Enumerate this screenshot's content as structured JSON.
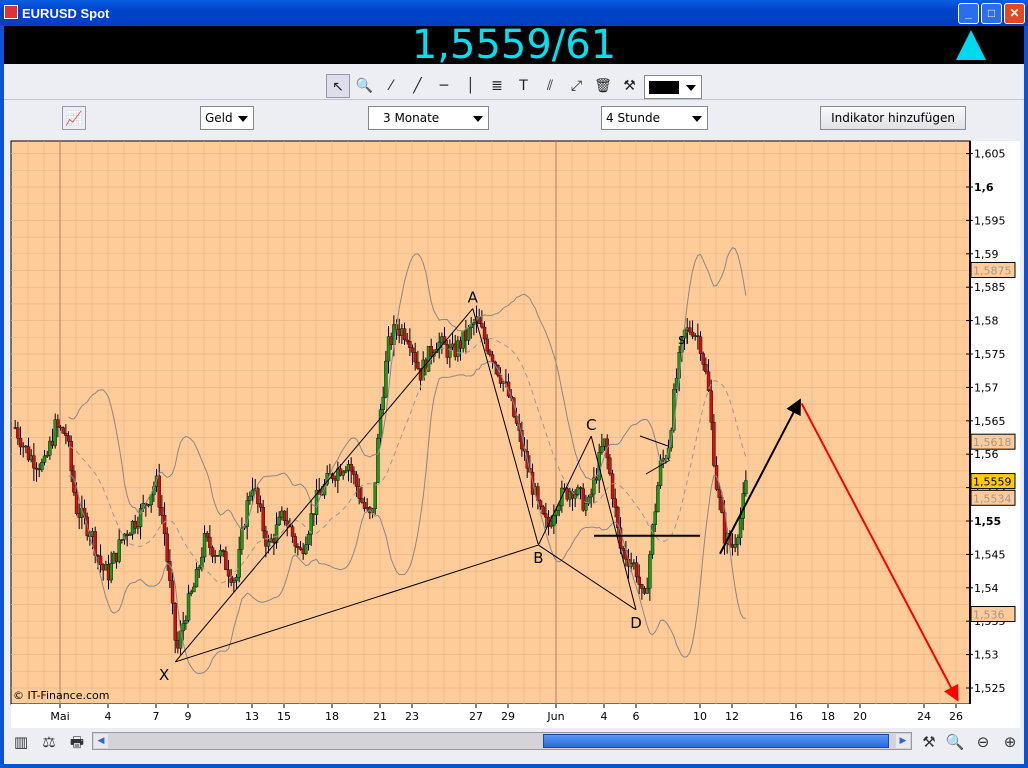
{
  "window": {
    "title": "EURUSD Spot",
    "minimize": "_",
    "maximize": "□",
    "close": "✕"
  },
  "quote": {
    "text": "1,5559/61",
    "direction": "up"
  },
  "toolbar": {
    "tools": [
      {
        "name": "pointer-tool",
        "glyph": "↖"
      },
      {
        "name": "zoom-tool",
        "glyph": "🔍"
      },
      {
        "name": "line-segment-tool",
        "glyph": "⁄"
      },
      {
        "name": "trendline-tool",
        "glyph": "╱"
      },
      {
        "name": "horizontal-line-tool",
        "glyph": "─"
      },
      {
        "name": "vertical-line-tool",
        "glyph": "│"
      },
      {
        "name": "fibonacci-tool",
        "glyph": "≣"
      },
      {
        "name": "text-tool",
        "glyph": "T"
      },
      {
        "name": "parallel-lines-tool",
        "glyph": "⫽"
      },
      {
        "name": "arrow-tool",
        "glyph": "⤢"
      },
      {
        "name": "delete-tool",
        "glyph": "🗑"
      },
      {
        "name": "settings-tool",
        "glyph": "⚒"
      }
    ],
    "color": "#000000"
  },
  "controls": {
    "price_type": "Geld",
    "range": "3 Monate",
    "interval": "4 Stunde",
    "add_indicator": "Indikator hinzufügen"
  },
  "chart_data": {
    "type": "candlestick",
    "symbol": "EURUSD",
    "ylim": [
      1.522,
      1.607
    ],
    "y_ticks": [
      "1,605",
      "1,6",
      "1,595",
      "1,59",
      "1,585",
      "1,58",
      "1,575",
      "1,57",
      "1,565",
      "1,56",
      "1,555",
      "1,55",
      "1,545",
      "1,54",
      "1,535",
      "1,53",
      "1,525"
    ],
    "y_tick_values": [
      1.605,
      1.6,
      1.595,
      1.59,
      1.585,
      1.58,
      1.575,
      1.57,
      1.565,
      1.56,
      1.555,
      1.55,
      1.545,
      1.54,
      1.535,
      1.53,
      1.525
    ],
    "x_labels": [
      {
        "t": "Mai",
        "d": 0
      },
      {
        "t": "4",
        "d": 3
      },
      {
        "t": "7",
        "d": 6
      },
      {
        "t": "9",
        "d": 8
      },
      {
        "t": "13",
        "d": 12
      },
      {
        "t": "15",
        "d": 14
      },
      {
        "t": "18",
        "d": 17
      },
      {
        "t": "21",
        "d": 20
      },
      {
        "t": "23",
        "d": 22
      },
      {
        "t": "27",
        "d": 26
      },
      {
        "t": "29",
        "d": 28
      },
      {
        "t": "Jun",
        "d": 31
      },
      {
        "t": "4",
        "d": 34
      },
      {
        "t": "6",
        "d": 36
      },
      {
        "t": "10",
        "d": 40
      },
      {
        "t": "12",
        "d": 42
      },
      {
        "t": "16",
        "d": 46
      },
      {
        "t": "18",
        "d": 48
      },
      {
        "t": "20",
        "d": 50
      },
      {
        "t": "24",
        "d": 54
      },
      {
        "t": "26",
        "d": 56
      }
    ],
    "xlim_days": [
      -2.9,
      57.8
    ],
    "price_path": [
      [
        -2.8,
        1.564
      ],
      [
        -2,
        1.56
      ],
      [
        -1,
        1.558
      ],
      [
        -0.3,
        1.564
      ],
      [
        0.4,
        1.563
      ],
      [
        1,
        1.552
      ],
      [
        2,
        1.548
      ],
      [
        2.6,
        1.543
      ],
      [
        3,
        1.542
      ],
      [
        4,
        1.548
      ],
      [
        5,
        1.551
      ],
      [
        6,
        1.556
      ],
      [
        6.5,
        1.549
      ],
      [
        7,
        1.537
      ],
      [
        7.3,
        1.53
      ],
      [
        7.8,
        1.536
      ],
      [
        8.5,
        1.541
      ],
      [
        9,
        1.547
      ],
      [
        10,
        1.545
      ],
      [
        11,
        1.541
      ],
      [
        11.5,
        1.55
      ],
      [
        12,
        1.556
      ],
      [
        13,
        1.546
      ],
      [
        14,
        1.551
      ],
      [
        15,
        1.545
      ],
      [
        16,
        1.553
      ],
      [
        17,
        1.557
      ],
      [
        18,
        1.559
      ],
      [
        19,
        1.552
      ],
      [
        19.5,
        1.55
      ],
      [
        20,
        1.566
      ],
      [
        20.5,
        1.576
      ],
      [
        21,
        1.579
      ],
      [
        21.8,
        1.578
      ],
      [
        22.5,
        1.572
      ],
      [
        23.5,
        1.577
      ],
      [
        24.5,
        1.575
      ],
      [
        25.5,
        1.578
      ],
      [
        26,
        1.58
      ],
      [
        27,
        1.575
      ],
      [
        28,
        1.569
      ],
      [
        29,
        1.56
      ],
      [
        30,
        1.551
      ],
      [
        30.5,
        1.549
      ],
      [
        31,
        1.553
      ],
      [
        32,
        1.555
      ],
      [
        33,
        1.552
      ],
      [
        34,
        1.562
      ],
      [
        34.5,
        1.555
      ],
      [
        35,
        1.546
      ],
      [
        36,
        1.543
      ],
      [
        36.5,
        1.537
      ],
      [
        37,
        1.548
      ],
      [
        37.5,
        1.558
      ],
      [
        38,
        1.561
      ],
      [
        38.5,
        1.571
      ],
      [
        39,
        1.578
      ],
      [
        39.5,
        1.579
      ],
      [
        40,
        1.577
      ],
      [
        40.5,
        1.57
      ],
      [
        41,
        1.556
      ],
      [
        41.5,
        1.548
      ],
      [
        42,
        1.546
      ],
      [
        42.5,
        1.55
      ],
      [
        43,
        1.557
      ]
    ],
    "overlays": [
      "Bollinger Bands"
    ],
    "price_markers": [
      {
        "label": "1,5875",
        "value": 1.5875,
        "highlight": false
      },
      {
        "label": "1,5618",
        "value": 1.5618,
        "highlight": false
      },
      {
        "label": "1,5559",
        "value": 1.5559,
        "highlight": true
      },
      {
        "label": "1,5534",
        "value": 1.5534,
        "highlight": false
      },
      {
        "label": "1,536",
        "value": 1.536,
        "highlight": false
      }
    ],
    "pattern_points": [
      {
        "label": "X",
        "d": 7.2,
        "p": 1.5289
      },
      {
        "label": "A",
        "d": 25.8,
        "p": 1.5818
      },
      {
        "label": "B",
        "d": 29.9,
        "p": 1.5464
      },
      {
        "label": "C",
        "d": 33.2,
        "p": 1.5627
      },
      {
        "label": "D",
        "d": 36.0,
        "p": 1.5367
      }
    ],
    "annotations": {
      "sl_label": "sl",
      "horizontal_level": 1.5478,
      "projection_up": [
        [
          41.25,
          1.5451
        ],
        [
          46.25,
          1.5681
        ]
      ],
      "projection_down": [
        [
          46.35,
          1.5676
        ],
        [
          56.1,
          1.5232
        ]
      ]
    },
    "copyright": "© IT-Finance.com"
  },
  "colors": {
    "chart_bg": "#ffcc99",
    "grid": "#e8b888",
    "bull": "#1a9a1a",
    "bear": "#cc1111",
    "quote": "#00e0f0"
  }
}
